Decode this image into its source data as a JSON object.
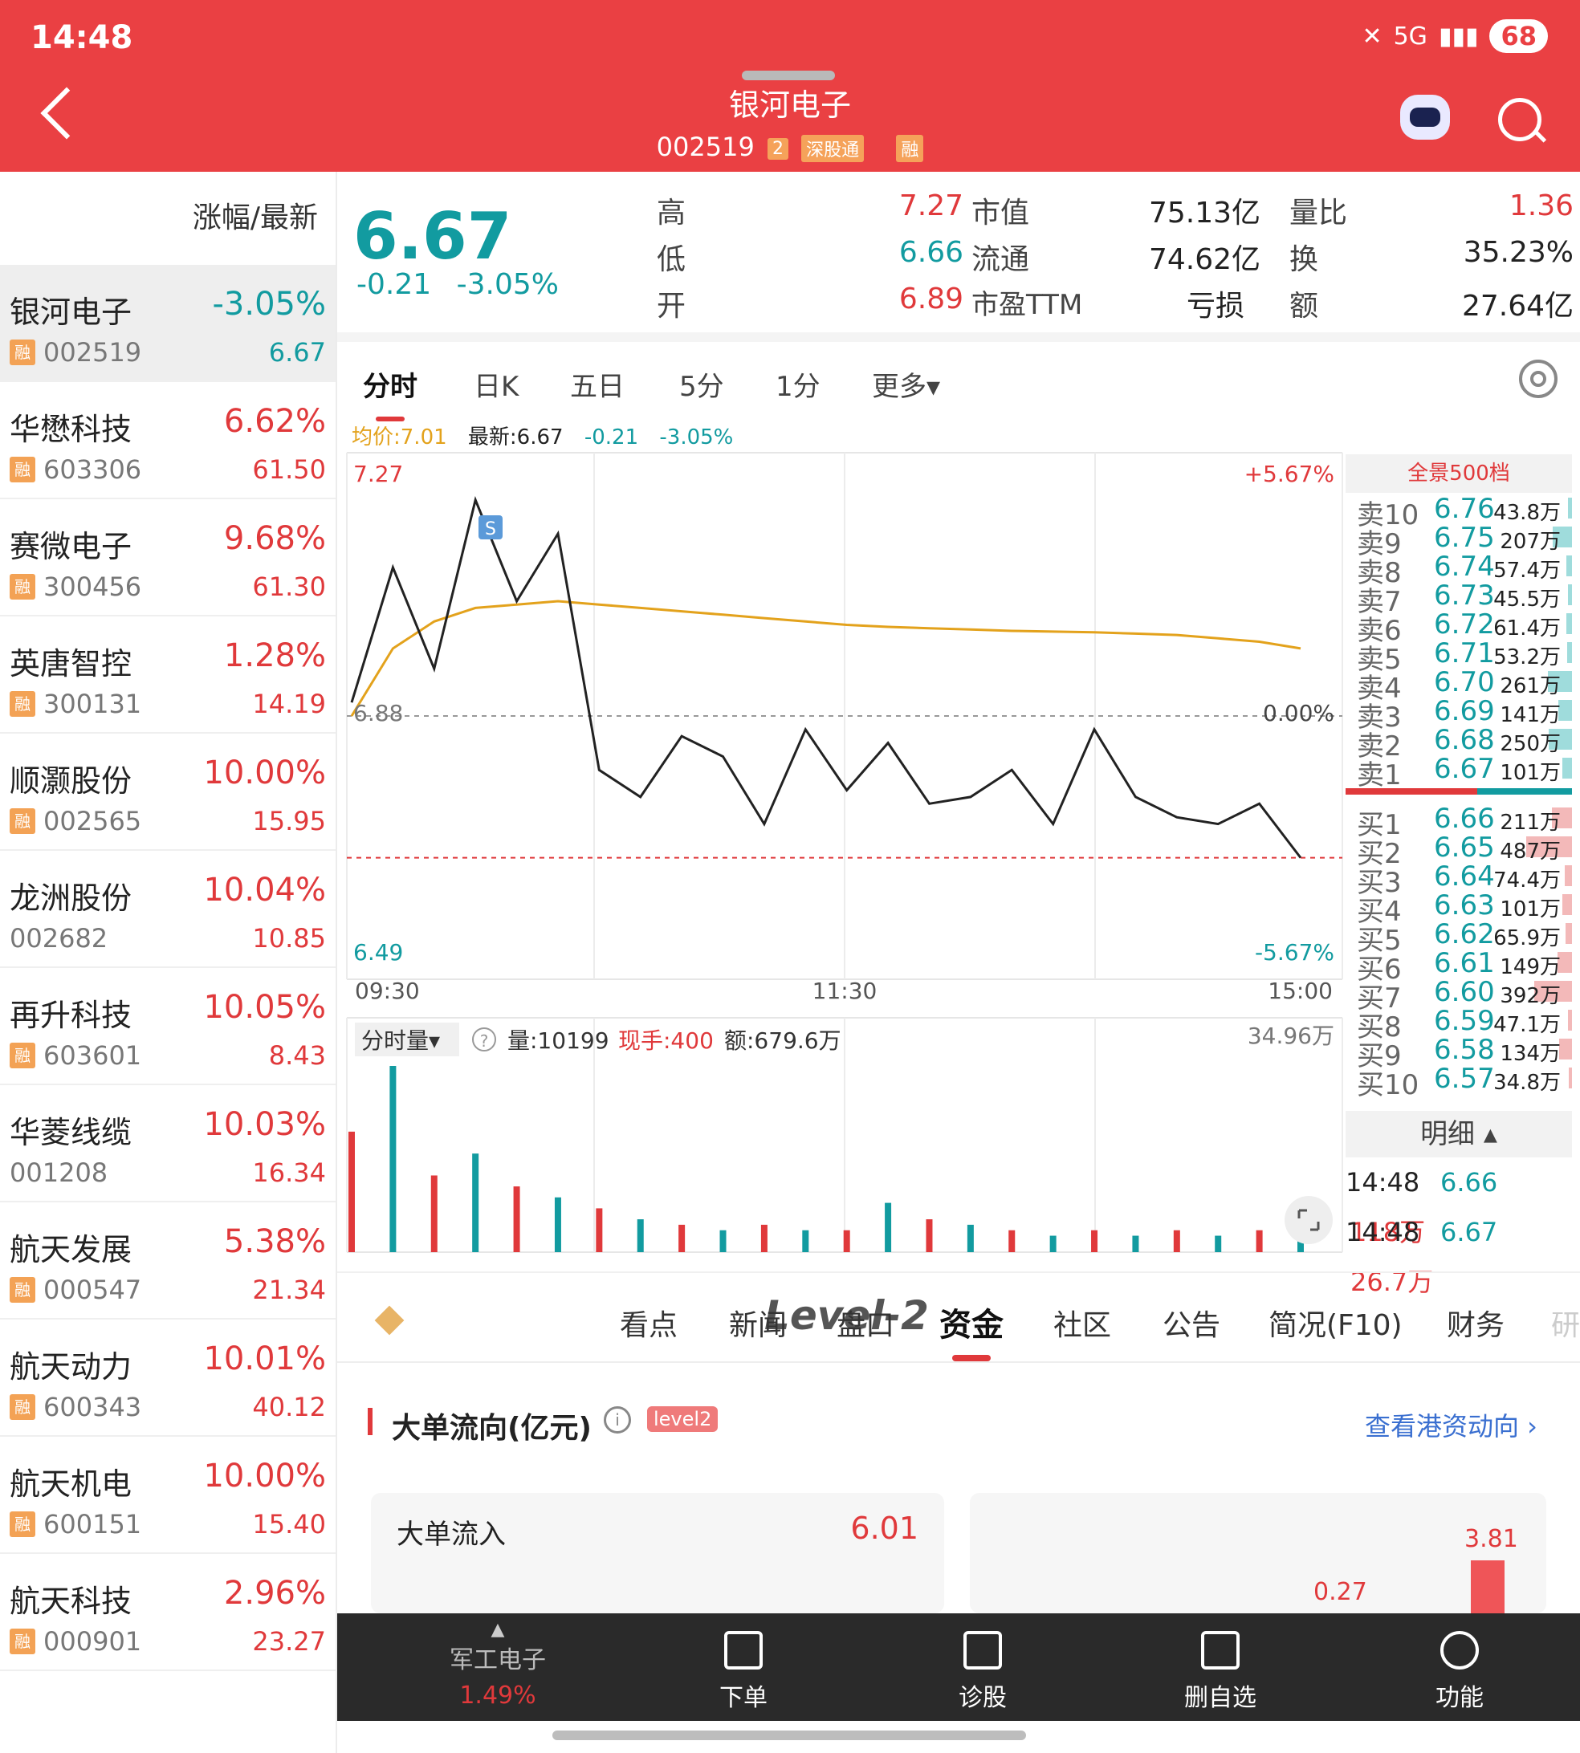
{
  "status": {
    "time": "14:48",
    "network": "5G",
    "battery": "68"
  },
  "header": {
    "title": "银河电子",
    "code": "002519",
    "num": "2",
    "tag1": "深股通",
    "tag2": "融"
  },
  "left_list": {
    "header": "涨幅/最新",
    "items": [
      {
        "name": "银河电子",
        "pct": "-3.05%",
        "code": "002519",
        "price": "6.67",
        "rong": true,
        "up": false
      },
      {
        "name": "华懋科技",
        "pct": "6.62%",
        "code": "603306",
        "price": "61.50",
        "rong": true,
        "up": true
      },
      {
        "name": "赛微电子",
        "pct": "9.68%",
        "code": "300456",
        "price": "61.30",
        "rong": true,
        "up": true
      },
      {
        "name": "英唐智控",
        "pct": "1.28%",
        "code": "300131",
        "price": "14.19",
        "rong": true,
        "up": true
      },
      {
        "name": "顺灏股份",
        "pct": "10.00%",
        "code": "002565",
        "price": "15.95",
        "rong": true,
        "up": true
      },
      {
        "name": "龙洲股份",
        "pct": "10.04%",
        "code": "002682",
        "price": "10.85",
        "rong": false,
        "up": true
      },
      {
        "name": "再升科技",
        "pct": "10.05%",
        "code": "603601",
        "price": "8.43",
        "rong": true,
        "up": true
      },
      {
        "name": "华菱线缆",
        "pct": "10.03%",
        "code": "001208",
        "price": "16.34",
        "rong": false,
        "up": true
      },
      {
        "name": "航天发展",
        "pct": "5.38%",
        "code": "000547",
        "price": "21.34",
        "rong": true,
        "up": true
      },
      {
        "name": "航天动力",
        "pct": "10.01%",
        "code": "600343",
        "price": "40.12",
        "rong": true,
        "up": true
      },
      {
        "name": "航天机电",
        "pct": "10.00%",
        "code": "600151",
        "price": "15.40",
        "rong": true,
        "up": true
      },
      {
        "name": "航天科技",
        "pct": "2.96%",
        "code": "000901",
        "price": "23.27",
        "rong": true,
        "up": true
      }
    ]
  },
  "quote": {
    "price": "6.67",
    "change": "-0.21",
    "change_pct": "-3.05%",
    "high_label": "高",
    "high": "7.27",
    "low_label": "低",
    "low": "6.66",
    "open_label": "开",
    "open": "6.89",
    "mcap_label": "市值",
    "mcap": "75.13亿",
    "float_label": "流通",
    "float": "74.62亿",
    "pe_label": "市盈TTM",
    "pe": "亏损",
    "vr_label": "量比",
    "vr": "1.36",
    "turn_label": "换",
    "turn": "35.23%",
    "amt_label": "额",
    "amt": "27.64亿"
  },
  "chart_tabs": [
    "分时",
    "日K",
    "五日",
    "5分",
    "1分",
    "更多▾"
  ],
  "avg_line": {
    "avg": "均价:7.01",
    "last": "最新:6.67",
    "chg": "-0.21",
    "pct": "-3.05%"
  },
  "chart_labels": {
    "top_price": "7.27",
    "top_pct": "+5.67%",
    "mid_price": "6.88",
    "mid_pct": "0.00%",
    "bot_price": "6.49",
    "bot_pct": "-5.67%",
    "t_start": "09:30",
    "t_mid": "11:30",
    "t_end": "15:00",
    "marker": "S"
  },
  "volume_bar": {
    "selector": "分时量▾",
    "help": "?",
    "vol": "量:10199",
    "hand": "现手:400",
    "amt": "额:679.6万",
    "max": "34.96万"
  },
  "colors": {
    "up": "#e0393b",
    "down": "#129ba0",
    "avg": "#e3a21c",
    "price_line": "#222222"
  },
  "chart_data": {
    "type": "line",
    "x": [
      "09:30",
      "09:40",
      "09:50",
      "10:00",
      "10:10",
      "10:20",
      "10:30",
      "10:40",
      "10:50",
      "11:00",
      "11:10",
      "11:20",
      "11:30",
      "13:10",
      "13:20",
      "13:30",
      "13:40",
      "13:50",
      "14:00",
      "14:10",
      "14:20",
      "14:30",
      "14:40",
      "14:48"
    ],
    "ylim": [
      6.49,
      7.27
    ],
    "y_right_ticks": [
      "+5.67%",
      "0.00%",
      "-5.67%"
    ],
    "series": [
      {
        "values": [
          6.9,
          7.1,
          6.95,
          7.2,
          7.05,
          7.15,
          6.8,
          6.76,
          6.85,
          6.82,
          6.72,
          6.86,
          6.77,
          6.84,
          6.75,
          6.76,
          6.8,
          6.72,
          6.86,
          6.76,
          6.73,
          6.72,
          6.75,
          6.67
        ]
      },
      {
        "values": [
          6.88,
          6.98,
          7.02,
          7.04,
          7.045,
          7.05,
          7.045,
          7.04,
          7.035,
          7.03,
          7.025,
          7.02,
          7.015,
          7.012,
          7.01,
          7.008,
          7.006,
          7.005,
          7.004,
          7.002,
          7.0,
          6.995,
          6.99,
          6.98
        ]
      }
    ],
    "volume": [
      22,
      34,
      14,
      18,
      12,
      10,
      8,
      6,
      5,
      4,
      5,
      4,
      4,
      9,
      6,
      5,
      4,
      3,
      4,
      3,
      4,
      3,
      4,
      6
    ]
  },
  "order_book": {
    "header": "全景500档",
    "asks": [
      {
        "label": "卖10",
        "price": "6.76",
        "vol": "43.8万",
        "w": 0.08
      },
      {
        "label": "卖9",
        "price": "6.75",
        "vol": "207万",
        "w": 0.4
      },
      {
        "label": "卖8",
        "price": "6.74",
        "vol": "57.4万",
        "w": 0.11
      },
      {
        "label": "卖7",
        "price": "6.73",
        "vol": "45.5万",
        "w": 0.09
      },
      {
        "label": "卖6",
        "price": "6.72",
        "vol": "61.4万",
        "w": 0.12
      },
      {
        "label": "卖5",
        "price": "6.71",
        "vol": "53.2万",
        "w": 0.1
      },
      {
        "label": "卖4",
        "price": "6.70",
        "vol": "261万",
        "w": 0.5
      },
      {
        "label": "卖3",
        "price": "6.69",
        "vol": "141万",
        "w": 0.28
      },
      {
        "label": "卖2",
        "price": "6.68",
        "vol": "250万",
        "w": 0.48
      },
      {
        "label": "卖1",
        "price": "6.67",
        "vol": "101万",
        "w": 0.2
      }
    ],
    "bids": [
      {
        "label": "买1",
        "price": "6.66",
        "vol": "211万",
        "w": 0.42
      },
      {
        "label": "买2",
        "price": "6.65",
        "vol": "487万",
        "w": 0.95
      },
      {
        "label": "买3",
        "price": "6.64",
        "vol": "74.4万",
        "w": 0.15
      },
      {
        "label": "买4",
        "price": "6.63",
        "vol": "101万",
        "w": 0.2
      },
      {
        "label": "买5",
        "price": "6.62",
        "vol": "65.9万",
        "w": 0.13
      },
      {
        "label": "买6",
        "price": "6.61",
        "vol": "149万",
        "w": 0.3
      },
      {
        "label": "买7",
        "price": "6.60",
        "vol": "392万",
        "w": 0.78
      },
      {
        "label": "买8",
        "price": "6.59",
        "vol": "47.1万",
        "w": 0.09
      },
      {
        "label": "买9",
        "price": "6.58",
        "vol": "134万",
        "w": 0.26
      },
      {
        "label": "买10",
        "price": "6.57",
        "vol": "34.8万",
        "w": 0.07
      }
    ],
    "split": 0.58,
    "detail_label": "明细 ▴",
    "details": [
      {
        "time": "14:48",
        "price": "6.66",
        "vol": "118万"
      },
      {
        "time": "14:48",
        "price": "6.67",
        "vol": "26.7万"
      }
    ]
  },
  "info_tabs": {
    "brand": "Level-2",
    "items": [
      "看点",
      "新闻",
      "盘口",
      "资金",
      "社区",
      "公告",
      "简况(F10)",
      "财务",
      "研"
    ],
    "selected": "资金"
  },
  "fund": {
    "title": "大单流向(亿元)",
    "info": "i",
    "tag": "level2",
    "link": "查看港资动向 ›",
    "inflow_label": "大单流入",
    "inflow": "6.01",
    "bar1": "0.27",
    "bar2": "3.81"
  },
  "bottom_bar": {
    "sector": "军工电子",
    "sector_pct": "1.49%",
    "order": "下单",
    "diagnose": "诊股",
    "remove": "删自选",
    "func": "功能"
  }
}
